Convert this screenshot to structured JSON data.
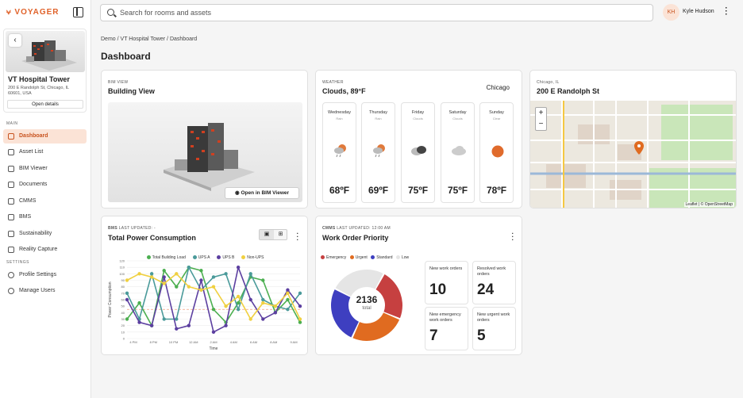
{
  "app": {
    "logo": "⩝ VOYAGER"
  },
  "building": {
    "name": "VT Hospital Tower",
    "address": "200 E Randolph St, Chicago, IL 60601, USA",
    "open_label": "Open details"
  },
  "sidebar": {
    "main_label": "MAIN",
    "settings_label": "SETTINGS",
    "items": [
      {
        "label": "Dashboard",
        "icon": "dashboard-icon"
      },
      {
        "label": "Asset List",
        "icon": "list-icon"
      },
      {
        "label": "BIM Viewer",
        "icon": "cube-icon"
      },
      {
        "label": "Documents",
        "icon": "folder-icon"
      },
      {
        "label": "CMMS",
        "icon": "folder-icon"
      },
      {
        "label": "BMS",
        "icon": "bms-icon"
      },
      {
        "label": "Sustainability",
        "icon": "plug-icon"
      },
      {
        "label": "Reality Capture",
        "icon": "capture-icon"
      }
    ],
    "settings": [
      {
        "label": "Profile Settings",
        "icon": "person-icon"
      },
      {
        "label": "Manage Users",
        "icon": "globe-icon"
      }
    ]
  },
  "search": {
    "placeholder": "Search for rooms and assets"
  },
  "user": {
    "initials": "KH",
    "name": "Kyle Hudson"
  },
  "breadcrumb": {
    "items": [
      "Demo",
      "VT Hospital Tower",
      "Dashboard"
    ],
    "sep": "/"
  },
  "page": {
    "title": "Dashboard"
  },
  "bim": {
    "tag": "BIM VIEW",
    "title": "Building View",
    "button": "Open in BIM Viewer"
  },
  "weather": {
    "tag": "WEATHER",
    "title": "Clouds, 89°F",
    "city": "Chicago",
    "days": [
      {
        "name": "Wednesday",
        "cond": "Rain",
        "temp": "68ºF",
        "icon": "rain-cloud-icon"
      },
      {
        "name": "Thursday",
        "cond": "Rain",
        "temp": "69ºF",
        "icon": "rain-cloud-icon"
      },
      {
        "name": "Friday",
        "cond": "Clouds",
        "temp": "75ºF",
        "icon": "dark-cloud-icon"
      },
      {
        "name": "Saturday",
        "cond": "Clouds",
        "temp": "75ºF",
        "icon": "cloud-icon"
      },
      {
        "name": "Sunday",
        "cond": "Clear",
        "temp": "78ºF",
        "icon": "sun-icon"
      }
    ]
  },
  "map": {
    "tag": "Chicago, IL",
    "title": "200 E Randolph St",
    "attribution": "Leaflet | © OpenStreetMap",
    "zoom_in": "+",
    "zoom_out": "−"
  },
  "power": {
    "tag": "BMS",
    "updated": "LAST UPDATED: -",
    "title": "Total Power Consumption",
    "chart_data": {
      "type": "line",
      "title": "Total Power Consumption",
      "xlabel": "Time",
      "ylabel": "Power Consumption",
      "ylim": [
        0,
        120
      ],
      "yticks": [
        0,
        10,
        20,
        30,
        40,
        50,
        60,
        70,
        80,
        90,
        100,
        110,
        120
      ],
      "x": [
        "4 PM",
        "8 PM",
        "10 PM",
        "12 AM",
        "2 AM",
        "4 AM",
        "6 AM",
        "8 AM",
        "10 AM",
        "12 AM",
        "2 AM",
        "4 AM",
        "6 AM",
        "8 AM",
        "9 AM"
      ],
      "xticks": [
        "4 PM",
        "8 PM",
        "10 PM",
        "12 AM",
        "2 AM",
        "4 AM",
        "6 AM",
        "8 AM",
        "9 AM"
      ],
      "series": [
        {
          "name": "Total Building Load",
          "color": "#4caf50",
          "values": [
            30,
            55,
            20,
            105,
            80,
            110,
            105,
            45,
            25,
            55,
            95,
            90,
            40,
            60,
            25
          ]
        },
        {
          "name": "UPS A",
          "color": "#4a9a9a",
          "values": [
            70,
            30,
            100,
            30,
            30,
            110,
            75,
            95,
            100,
            45,
            100,
            60,
            50,
            45,
            70
          ]
        },
        {
          "name": "UPS B",
          "color": "#5c3fa0",
          "values": [
            60,
            25,
            20,
            95,
            15,
            20,
            90,
            10,
            20,
            110,
            60,
            30,
            40,
            75,
            50
          ]
        },
        {
          "name": "Non-UPS",
          "color": "#f0d040",
          "values": [
            90,
            100,
            95,
            85,
            100,
            80,
            75,
            80,
            50,
            65,
            30,
            55,
            50,
            70,
            30
          ]
        }
      ],
      "avg_line": {
        "value": 45,
        "color": "#f0a080"
      }
    }
  },
  "work": {
    "tag": "CMMS",
    "updated": "LAST UPDATED: 12:00 AM",
    "title": "Work Order Priority",
    "chart_data": {
      "type": "pie",
      "title": "Work Order Priority",
      "total": 2136,
      "total_label": "total",
      "categories": [
        "Emergency",
        "Urgent",
        "Standard",
        "Low"
      ],
      "colors": [
        "#c64040",
        "#e06b20",
        "#3e3fc0",
        "#e5e5e5"
      ],
      "values": [
        498,
        545,
        553,
        540
      ]
    },
    "stats": [
      {
        "label": "New work orders",
        "value": "10"
      },
      {
        "label": "Resolved work orders",
        "value": "24"
      },
      {
        "label": "New emergency work orders",
        "value": "7"
      },
      {
        "label": "New urgent work orders",
        "value": "5"
      }
    ]
  }
}
